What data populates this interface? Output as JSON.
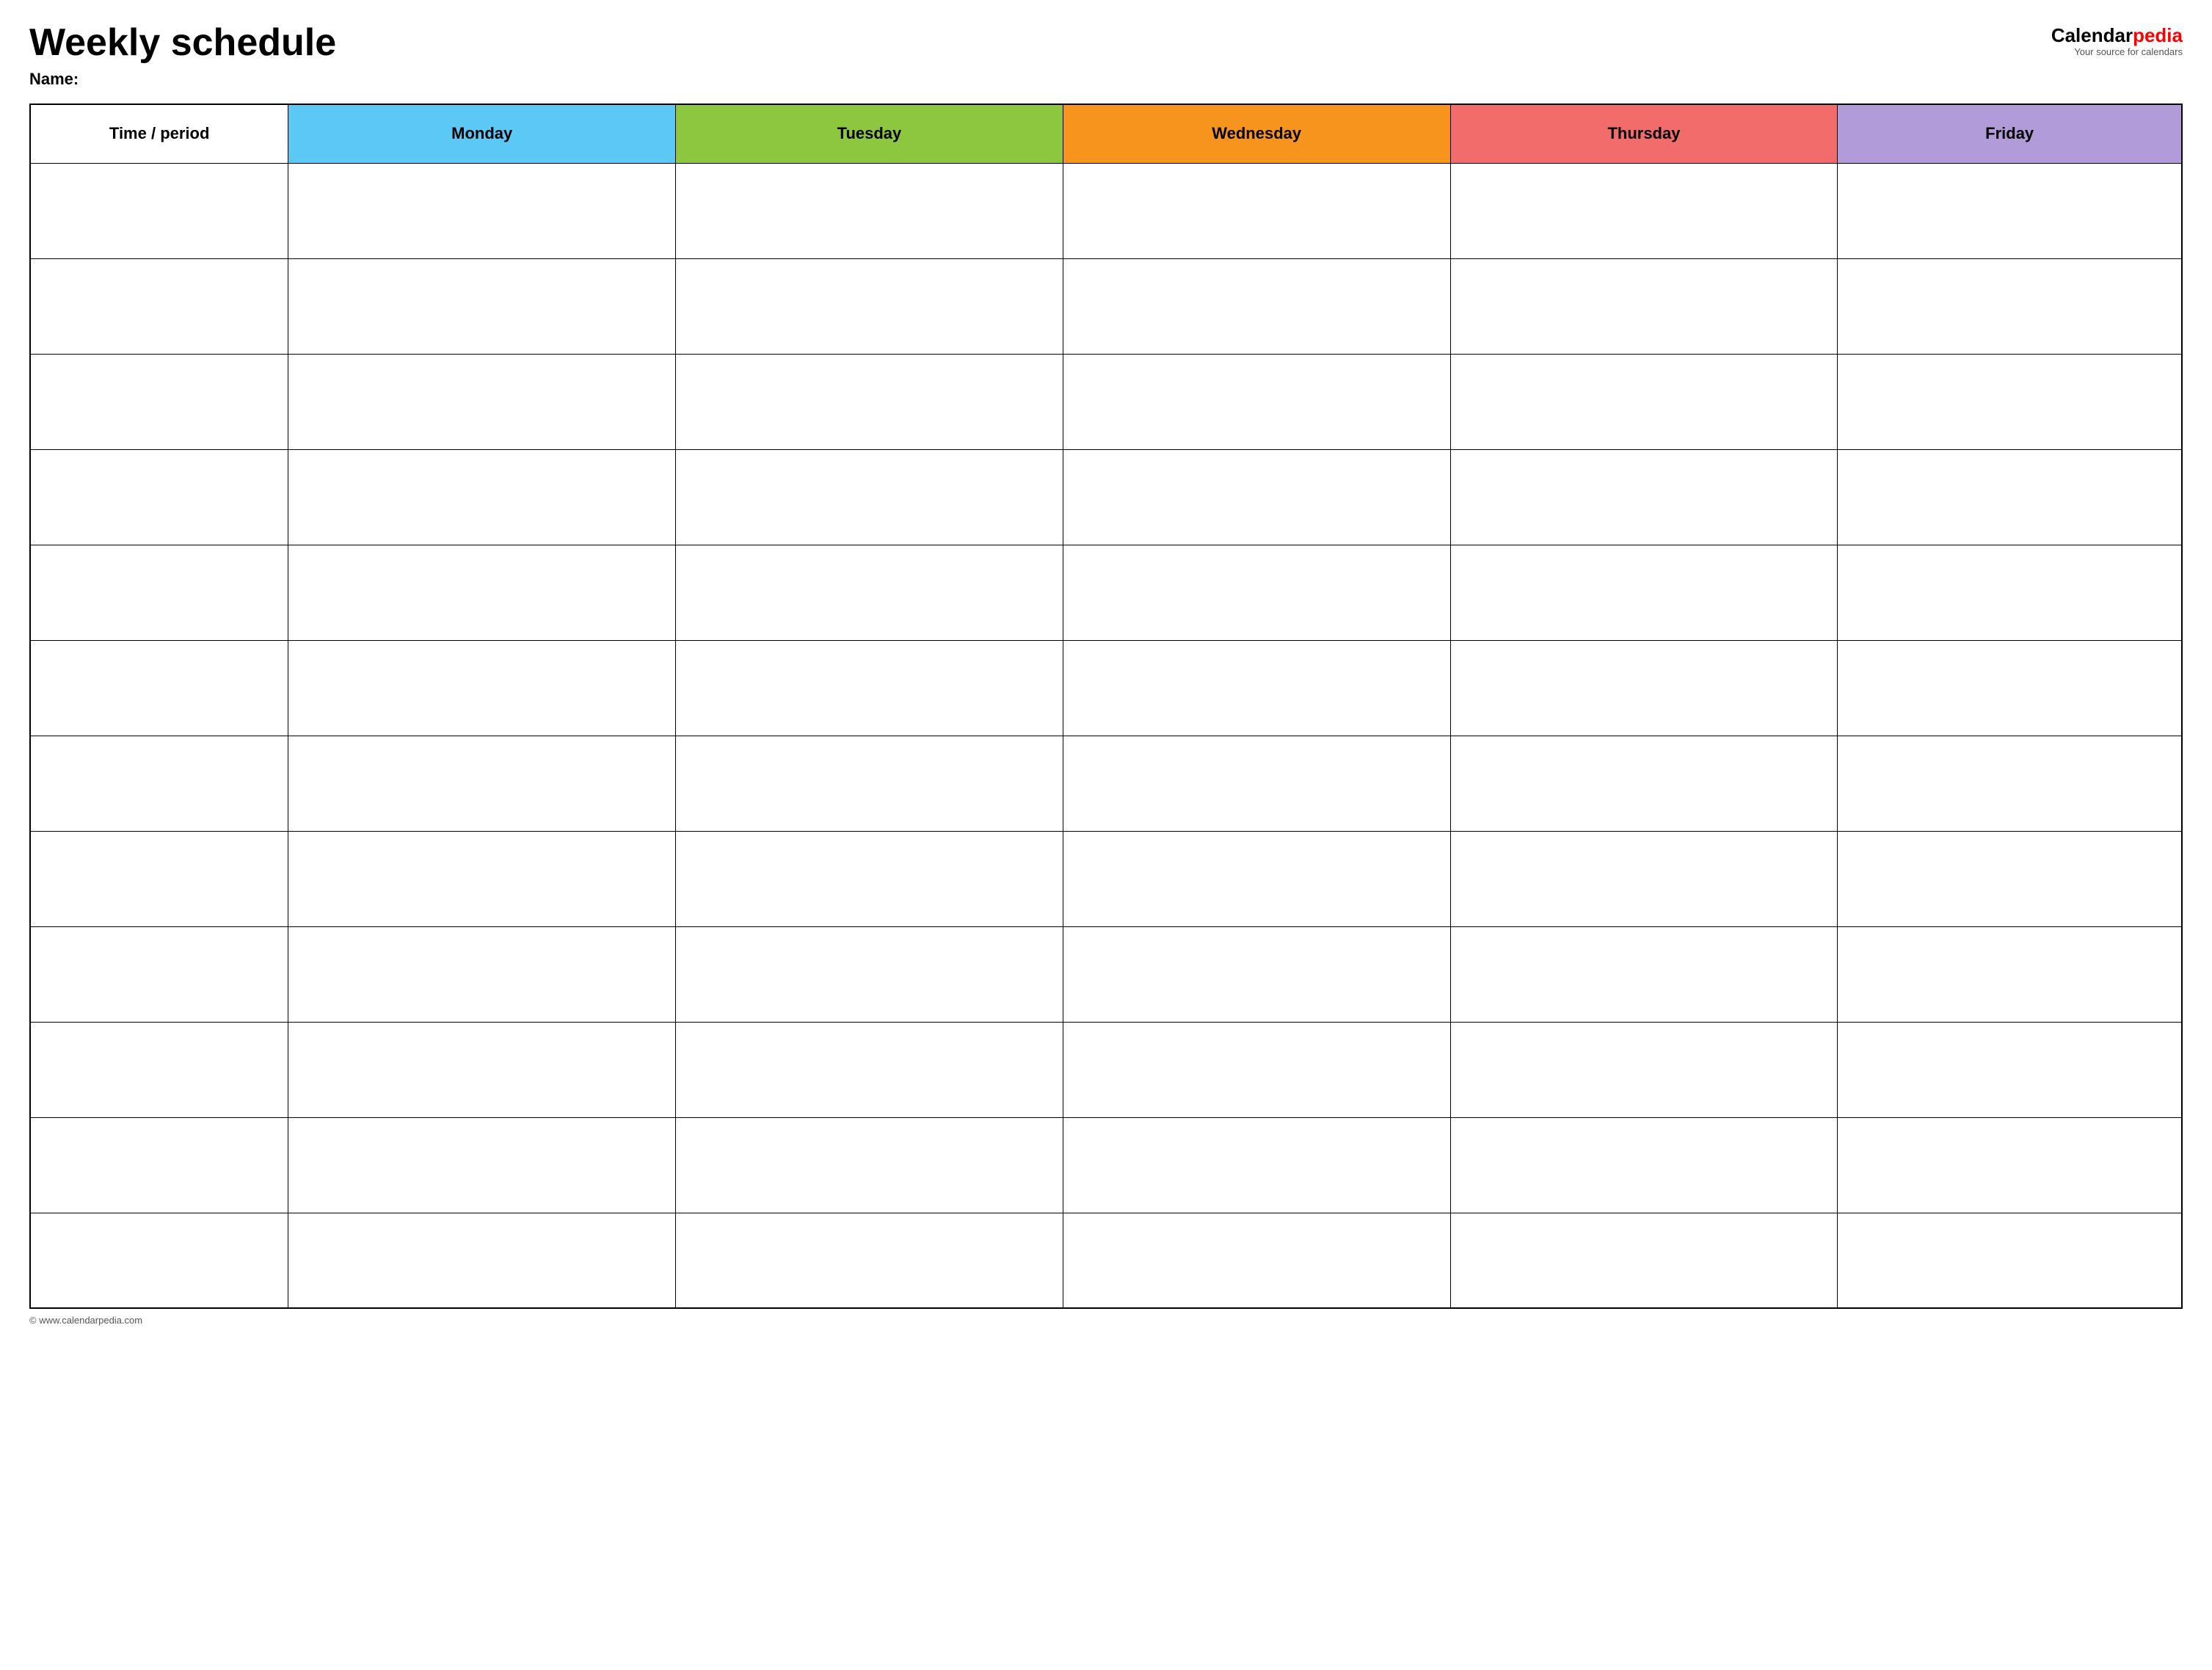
{
  "header": {
    "main_title": "Weekly schedule",
    "name_label": "Name:",
    "logo": {
      "calendar": "Calendar",
      "pedia": "pedia",
      "tagline": "Your source for calendars"
    }
  },
  "table": {
    "columns": [
      {
        "id": "time",
        "label": "Time / period",
        "color": "#ffffff",
        "text_color": "#000000"
      },
      {
        "id": "monday",
        "label": "Monday",
        "color": "#5bc8f5",
        "text_color": "#000000"
      },
      {
        "id": "tuesday",
        "label": "Tuesday",
        "color": "#8dc63f",
        "text_color": "#000000"
      },
      {
        "id": "wednesday",
        "label": "Wednesday",
        "color": "#f7941d",
        "text_color": "#000000"
      },
      {
        "id": "thursday",
        "label": "Thursday",
        "color": "#f26c6c",
        "text_color": "#000000"
      },
      {
        "id": "friday",
        "label": "Friday",
        "color": "#b19cd9",
        "text_color": "#000000"
      }
    ],
    "row_count": 12
  },
  "footer": {
    "url": "© www.calendarpedia.com"
  }
}
